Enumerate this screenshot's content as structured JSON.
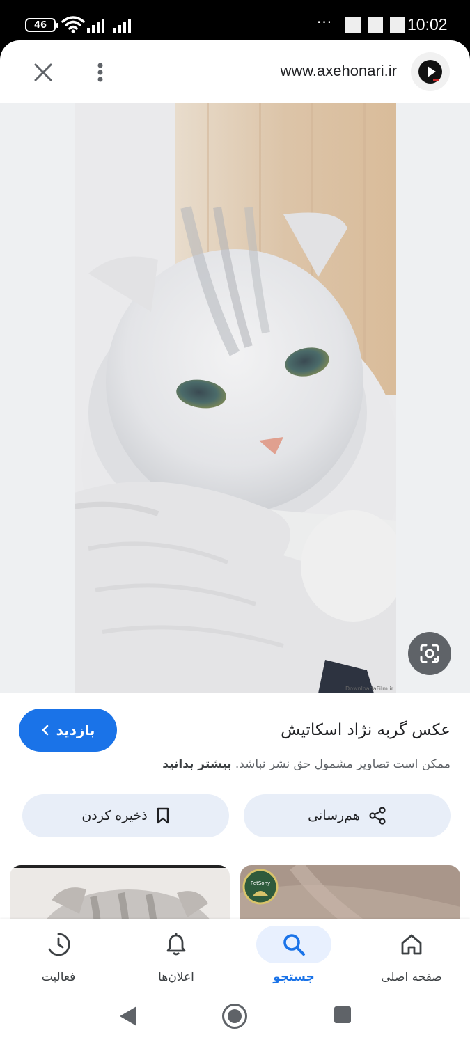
{
  "status_bar": {
    "battery": "46",
    "time": "10:02",
    "overflow": "···"
  },
  "browser": {
    "url": "www.axehonari.ir",
    "favicon_icon": "play-icon"
  },
  "image": {
    "watermark": "DownloadaFilm.ir"
  },
  "result": {
    "title": "عکس گربه نژاد اسکاتیش",
    "visit_label": "بازدید",
    "copyright_text": "ممکن است تصاویر مشمول حق نشر نباشد.",
    "learn_more": "بیشتر بدانید",
    "share_label": "هم‌رسانی",
    "save_label": "ذخیره کردن"
  },
  "related": {
    "badge_text": "PetSony"
  },
  "bottom_nav": {
    "items": [
      {
        "label": "فعالیت",
        "icon": "activity-icon"
      },
      {
        "label": "اعلان‌ها",
        "icon": "bell-icon"
      },
      {
        "label": "جستجو",
        "icon": "search-icon",
        "active": true
      },
      {
        "label": "صفحه اصلی",
        "icon": "home-icon"
      }
    ]
  },
  "colors": {
    "accent": "#1a73e8",
    "chip_bg": "#e8eef8",
    "stage_bg": "#eef0f2"
  }
}
